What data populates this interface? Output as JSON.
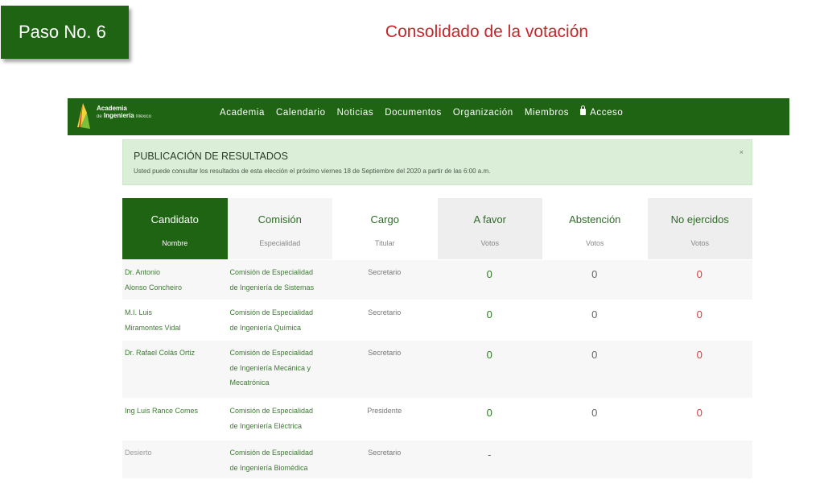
{
  "step": {
    "label": "Paso No. 6"
  },
  "heading": "Consolidado de la votación",
  "navbar": {
    "logo": {
      "line1": "Academia",
      "line2_prefix": "de",
      "line2_main": "Ingeniería",
      "line2_suffix": "México"
    },
    "links": [
      "Academia",
      "Calendario",
      "Noticias",
      "Documentos",
      "Organización",
      "Miembros"
    ],
    "login": "Acceso"
  },
  "alert": {
    "title": "PUBLICACIÓN DE RESULTADOS",
    "text": "Usted puede consultar los resultados de esta elección el próximo viernes 18 de Septiembre del 2020 a partir de las 6:00 a.m.",
    "close": "×"
  },
  "table": {
    "headers": [
      {
        "title": "Candidato",
        "sub": "Nombre"
      },
      {
        "title": "Comisión",
        "sub": "Especialidad"
      },
      {
        "title": "Cargo",
        "sub": "Titular"
      },
      {
        "title": "A favor",
        "sub": "Votos"
      },
      {
        "title": "Abstención",
        "sub": "Votos"
      },
      {
        "title": "No ejercidos",
        "sub": "Votos"
      }
    ],
    "rows": [
      {
        "candidate": [
          "Dr. Antonio",
          "Alonso Concheiro"
        ],
        "commission": [
          "Comisión de Especialidad",
          "de Ingeniería de Sistemas"
        ],
        "role": "Secretario",
        "favor": "0",
        "abst": "0",
        "noej": "0"
      },
      {
        "candidate": [
          "M.I. Luis",
          "Miramontes Vidal"
        ],
        "commission": [
          "Comisión de Especialidad",
          "de Ingeniería Química"
        ],
        "role": "Secretario",
        "favor": "0",
        "abst": "0",
        "noej": "0"
      },
      {
        "candidate": [
          "Dr. Rafael Colás Ortiz"
        ],
        "commission": [
          "Comisión de Especialidad",
          "de Ingeniería Mecánica y",
          "Mecatrónica"
        ],
        "role": "Secretario",
        "favor": "0",
        "abst": "0",
        "noej": "0"
      },
      {
        "candidate": [
          "Ing Luis Rance Comes"
        ],
        "commission": [
          "Comisión de Especialidad",
          "de Ingeniería Eléctrica"
        ],
        "role": "Presidente",
        "favor": "0",
        "abst": "0",
        "noej": "0"
      },
      {
        "candidate": [
          "Desierto"
        ],
        "commission": [
          "Comisión de Especialidad",
          "de Ingeniería Biomédica"
        ],
        "role": "Secretario",
        "favor": "-",
        "abst": "",
        "noej": ""
      }
    ]
  },
  "colors": {
    "brand_green": "#1f6413",
    "accent_red": "#c3272b",
    "alert_bg": "#dbeed7"
  }
}
